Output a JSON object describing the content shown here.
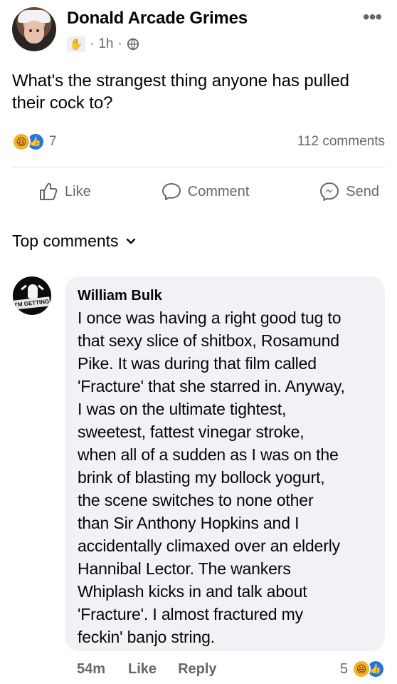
{
  "post": {
    "author": "Donald Arcade Grimes",
    "time": "1h",
    "text": "What's the strangest thing anyone has pulled their cock to?",
    "reaction_count": "7",
    "comments_count": "112 comments",
    "badge_icon": "hand-badge-icon",
    "privacy_icon": "globe-icon"
  },
  "actions": {
    "like": "Like",
    "comment": "Comment",
    "send": "Send"
  },
  "comments_section": {
    "label": "Top comments"
  },
  "comment": {
    "author": "William Bulk",
    "text": "I once was having a right good tug to\nthat sexy slice of shitbox, Rosamund\nPike. It was during that film called\n'Fracture' that she starred in. Anyway,\nI was on the ultimate tightest,\nsweetest, fattest vinegar stroke,\nwhen all of a sudden as I was on the\nbrink of blasting my bollock yogurt,\nthe scene switches to none other\nthan Sir Anthony Hopkins and I\naccidentally climaxed over an elderly\nHannibal Lector. The wankers\nWhiplash kicks in and talk about\n'Fracture'. I almost fractured my\nfeckin' banjo string.",
    "time": "54m",
    "like": "Like",
    "reply": "Reply",
    "reaction_count": "5",
    "avatar_caption": "I'M GETTING"
  },
  "colors": {
    "background": "#ffffff",
    "bubble": "#f0f2f5",
    "meta_text": "#65676b",
    "like_blue": "#1877f2",
    "haha_yellow": "#f7b125"
  }
}
